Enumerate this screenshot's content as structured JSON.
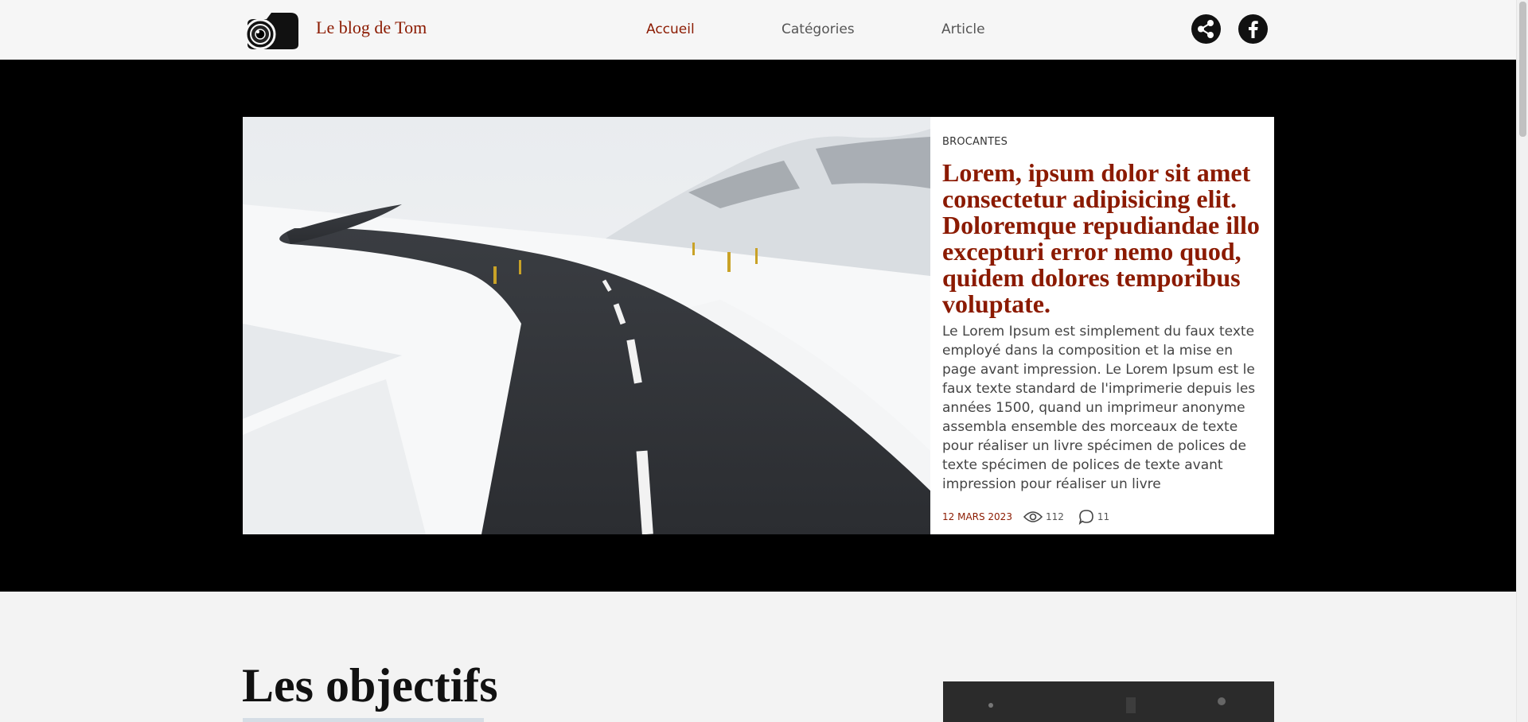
{
  "header": {
    "brand": "Le blog de Tom",
    "nav": [
      {
        "label": "Accueil",
        "active": true
      },
      {
        "label": "Catégories",
        "active": false
      },
      {
        "label": "Article",
        "active": false
      }
    ],
    "social": [
      {
        "icon": "share-icon"
      },
      {
        "icon": "facebook-icon"
      }
    ]
  },
  "featured": {
    "category": "BROCANTES",
    "title": "Lorem, ipsum dolor sit amet consectetur adipisicing elit. Doloremque repudiandae illo excepturi error nemo quod, quidem dolores temporibus voluptate.",
    "excerpt": "Le Lorem Ipsum est simplement du faux texte employé dans la composition et la mise en page avant impression. Le Lorem Ipsum est le faux texte standard de l'imprimerie depuis les années 1500, quand un imprimeur anonyme assembla ensemble des morceaux de texte pour réaliser un livre spécimen de polices de texte spécimen de polices de texte avant impression pour réaliser un livre",
    "date": "12 MARS 2023",
    "views": "112",
    "comments": "11",
    "image": "snowy-road-photo"
  },
  "section": {
    "title": "Les objectifs"
  },
  "colors": {
    "accent": "#8b1a00",
    "hero_bg": "#000000",
    "page_bg": "#f3f3f3"
  }
}
